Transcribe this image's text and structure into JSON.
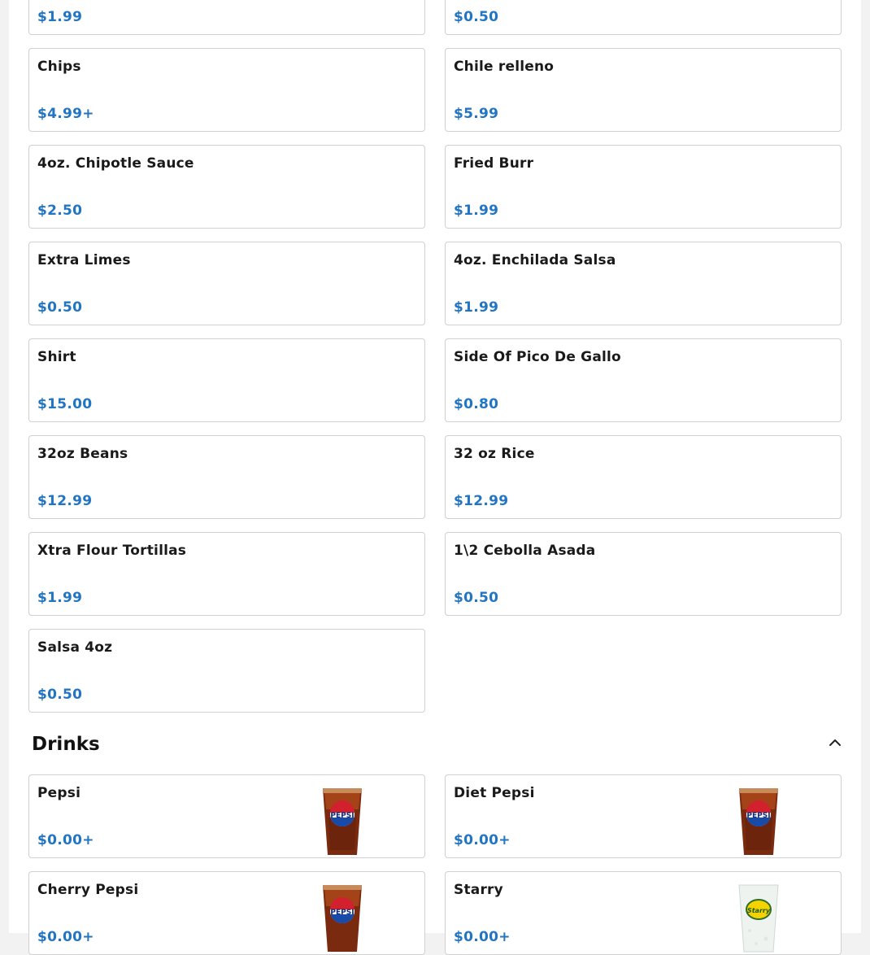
{
  "sides": {
    "items": [
      {
        "name": "",
        "price": "$1.99"
      },
      {
        "name": "",
        "price": "$0.50"
      },
      {
        "name": "Chips",
        "price": "$4.99+"
      },
      {
        "name": "Chile relleno",
        "price": "$5.99"
      },
      {
        "name": "4oz. Chipotle Sauce",
        "price": "$2.50"
      },
      {
        "name": "Fried Burr",
        "price": "$1.99"
      },
      {
        "name": "Extra Limes",
        "price": "$0.50"
      },
      {
        "name": "4oz. Enchilada Salsa",
        "price": "$1.99"
      },
      {
        "name": "Shirt",
        "price": "$15.00"
      },
      {
        "name": "Side Of Pico De Gallo",
        "price": "$0.80"
      },
      {
        "name": "32oz Beans",
        "price": "$12.99"
      },
      {
        "name": "32 oz Rice",
        "price": "$12.99"
      },
      {
        "name": "Xtra Flour Tortillas",
        "price": "$1.99"
      },
      {
        "name": "1\\2 Cebolla Asada",
        "price": "$0.50"
      },
      {
        "name": "Salsa 4oz",
        "price": "$0.50"
      }
    ]
  },
  "drinks": {
    "title": "Drinks",
    "collapse_icon": "chevron-up-icon",
    "items": [
      {
        "name": "Pepsi",
        "price": "$0.00+",
        "image": "pepsi-cup-image",
        "logo_text": "PEPSI"
      },
      {
        "name": "Diet Pepsi",
        "price": "$0.00+",
        "image": "diet-pepsi-cup-image",
        "logo_text": "PEPSI"
      },
      {
        "name": "Cherry Pepsi",
        "price": "$0.00+",
        "image": "cherry-pepsi-cup-image",
        "logo_text": "PEPSI"
      },
      {
        "name": "Starry",
        "price": "$0.00+",
        "image": "starry-cup-image",
        "logo_text": "Starry"
      }
    ]
  },
  "colors": {
    "price": "#2275c2",
    "text": "#1a1a1a",
    "border": "#d0d0d0",
    "background": "#f2f2f2"
  }
}
